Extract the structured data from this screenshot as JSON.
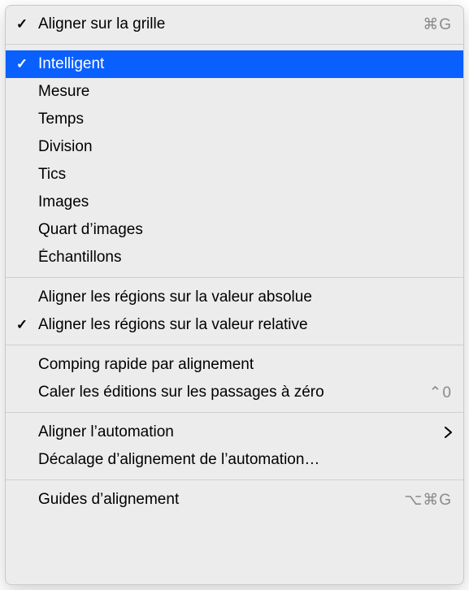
{
  "menu": {
    "groups": [
      [
        {
          "id": "align-to-grid",
          "label": "Aligner sur la grille",
          "checked": true,
          "shortcut": "⌘G",
          "submenu": false,
          "highlight": false
        }
      ],
      [
        {
          "id": "mode-intelligent",
          "label": "Intelligent",
          "checked": true,
          "shortcut": "",
          "submenu": false,
          "highlight": true
        },
        {
          "id": "mode-measure",
          "label": "Mesure",
          "checked": false,
          "shortcut": "",
          "submenu": false,
          "highlight": false
        },
        {
          "id": "mode-time",
          "label": "Temps",
          "checked": false,
          "shortcut": "",
          "submenu": false,
          "highlight": false
        },
        {
          "id": "mode-division",
          "label": "Division",
          "checked": false,
          "shortcut": "",
          "submenu": false,
          "highlight": false
        },
        {
          "id": "mode-ticks",
          "label": "Tics",
          "checked": false,
          "shortcut": "",
          "submenu": false,
          "highlight": false
        },
        {
          "id": "mode-frames",
          "label": "Images",
          "checked": false,
          "shortcut": "",
          "submenu": false,
          "highlight": false
        },
        {
          "id": "mode-quarter-frames",
          "label": "Quart d’images",
          "checked": false,
          "shortcut": "",
          "submenu": false,
          "highlight": false
        },
        {
          "id": "mode-samples",
          "label": "Échantillons",
          "checked": false,
          "shortcut": "",
          "submenu": false,
          "highlight": false
        }
      ],
      [
        {
          "id": "snap-regions-absolute",
          "label": "Aligner les régions sur la valeur absolue",
          "checked": false,
          "shortcut": "",
          "submenu": false,
          "highlight": false
        },
        {
          "id": "snap-regions-relative",
          "label": "Aligner les régions sur la valeur relative",
          "checked": true,
          "shortcut": "",
          "submenu": false,
          "highlight": false
        }
      ],
      [
        {
          "id": "quick-swipe-comping",
          "label": "Comping rapide par alignement",
          "checked": false,
          "shortcut": "",
          "submenu": false,
          "highlight": false
        },
        {
          "id": "snap-edits-zero",
          "label": "Caler les éditions sur les passages à zéro",
          "checked": false,
          "shortcut": "⌃0",
          "submenu": false,
          "highlight": false
        }
      ],
      [
        {
          "id": "snap-automation",
          "label": "Aligner l’automation",
          "checked": false,
          "shortcut": "",
          "submenu": true,
          "highlight": false
        },
        {
          "id": "automation-snap-offset",
          "label": "Décalage d’alignement de l’automation…",
          "checked": false,
          "shortcut": "",
          "submenu": false,
          "highlight": false
        }
      ],
      [
        {
          "id": "alignment-guides",
          "label": "Guides d’alignement",
          "checked": false,
          "shortcut": "⌥⌘G",
          "submenu": false,
          "highlight": false
        }
      ]
    ],
    "checkGlyph": "✓"
  }
}
